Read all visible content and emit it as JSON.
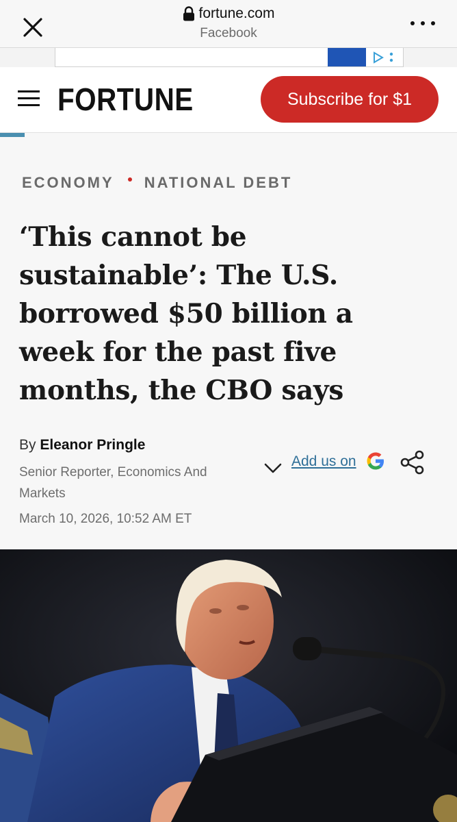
{
  "browser": {
    "domain": "fortune.com",
    "source": "Facebook",
    "icons": [
      "close-icon",
      "lock-icon",
      "more-icon"
    ]
  },
  "header": {
    "logo": "FORTUNE",
    "subscribe_label": "Subscribe for $1",
    "brand_color": "#cc2a26"
  },
  "article": {
    "categories": [
      "ECONOMY",
      "NATIONAL DEBT"
    ],
    "headline": "‘This cannot be sustainable’: The U.S. borrowed $50 billion a week for the past five months, the CBO says",
    "byline_prefix": "By",
    "author": "Eleanor Pringle",
    "author_role": "Senior Reporter, Economics And Markets",
    "date": "March 10, 2026, 10:52 AM ET",
    "add_us_label": "Add us on",
    "link_color": "#2f6f98"
  },
  "hero_image": {
    "description_icon": "photo-speaker-at-podium"
  }
}
